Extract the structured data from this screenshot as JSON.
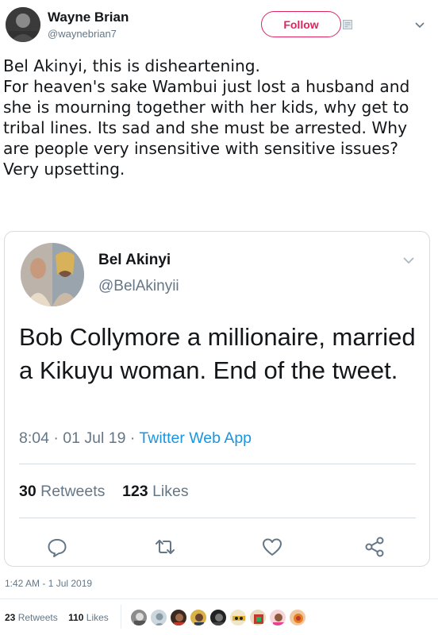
{
  "tweet": {
    "author_name": "Wayne Brian",
    "author_handle": "@waynebrian7",
    "follow_label": "Follow",
    "text": "Bel Akinyi, this is disheartening.\nFor heaven's sake Wambui just lost a husband and she is mourning together with her kids, why get to tribal lines. Its sad and she must be arrested. Why are people very insensitive with sensitive issues?\nVery upsetting.",
    "timestamp": "1:42 AM - 1 Jul 2019",
    "retweets_count": "23",
    "retweets_label": "Retweets",
    "likes_count": "110",
    "likes_label": "Likes"
  },
  "quoted": {
    "author_name": "Bel Akinyi",
    "author_handle": "@BelAkinyii",
    "text": "Bob Collymore a millionaire, married a Kikuyu woman. End of the tweet.",
    "time": "8:04 · 01 Jul 19 · ",
    "source": "Twitter Web App",
    "retweets_count": "30",
    "retweets_label": "Retweets",
    "likes_count": "123",
    "likes_label": "Likes"
  },
  "icons": {
    "reply": "reply-icon",
    "retweet": "retweet-icon",
    "like": "heart-icon",
    "share": "share-icon",
    "menu": "chevron-down-icon",
    "dm": "direct-message-icon"
  },
  "colors": {
    "follow_accent": "#e0245e",
    "link": "#1b95e0",
    "secondary_text": "#657786",
    "primary_text": "#14171a",
    "border": "#d6dbdf"
  }
}
